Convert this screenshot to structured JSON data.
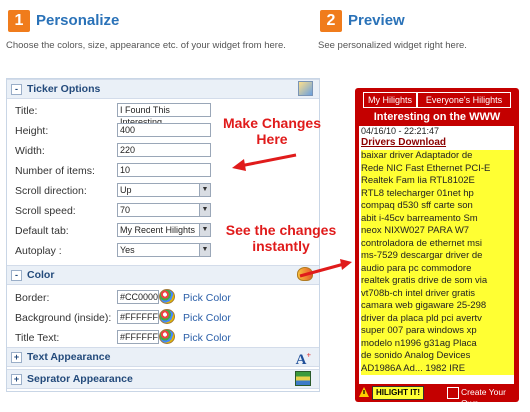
{
  "step1": {
    "number": "1",
    "title": "Personalize",
    "desc": "Choose the colors, size, appearance etc. of your widget from here."
  },
  "step2": {
    "number": "2",
    "title": "Preview",
    "desc": "See personalized widget right here."
  },
  "ticker_options": {
    "title": "Ticker Options",
    "toggle": "-",
    "fields": [
      {
        "label": "Title:",
        "value": "I Found This Interesting"
      },
      {
        "label": "Height:",
        "value": "400"
      },
      {
        "label": "Width:",
        "value": "220"
      },
      {
        "label": "Number of items:",
        "value": "10"
      },
      {
        "label": "Scroll direction:",
        "value": "Up"
      },
      {
        "label": "Scroll speed:",
        "value": "70"
      },
      {
        "label": "Default tab:",
        "value": "My Recent Hilights"
      },
      {
        "label": "Autoplay :",
        "value": "Yes"
      }
    ]
  },
  "color": {
    "title": "Color",
    "toggle": "-",
    "fields": [
      {
        "label": "Border:",
        "value": "#CC0000",
        "pick": "Pick Color"
      },
      {
        "label": "Background (inside):",
        "value": "#FFFFFF",
        "pick": "Pick Color"
      },
      {
        "label": "Title Text:",
        "value": "#FFFFFF",
        "pick": "Pick Color"
      }
    ]
  },
  "text_appearance": {
    "title": "Text Appearance",
    "toggle": "+"
  },
  "separator_appearance": {
    "title": "Seprator Appearance",
    "toggle": "+"
  },
  "callouts": {
    "top_line1": "Make Changes",
    "top_line2": "Here",
    "bottom_line1": "See the changes",
    "bottom_line2": "instantly"
  },
  "widget": {
    "tabs": [
      "My Hilights",
      "Everyone's Hilights"
    ],
    "header": "Interesting on the WWW",
    "timestamp": "04/16/10 - 22:21:47",
    "link": "Drivers Download",
    "body_lines": [
      "baixar driver Adaptador de",
      "Rede NIC Fast Ethernet PCI-E",
      "Realtek Fam lia RTL8102E",
      "RTL8 telecharger 01net hp",
      "compaq d530 sff carte son",
      "abit i-45cv barreamento Sm",
      "neox NIXW027 PARA W7",
      "controladora de ethernet msi",
      "ms-7529 descargar driver de",
      "audio para pc commodore",
      "realtek gratis drive de som via",
      "vt708b-ch intel driver gratis",
      "camara web gigaware 25-298",
      "driver da placa pld pci avertv",
      "super 007 para windows xp",
      "modelo n1996 g31ag Placa",
      "de sonido Analog Devices",
      "AD1986A Ad... 1982 IRE"
    ],
    "footer_left": "HILIGHT IT!",
    "footer_right": "Create Your Own"
  },
  "colors": {
    "accent": "#f07c1c",
    "title_blue": "#2a72b8",
    "widget_red": "#c40000",
    "highlight": "#ffff33",
    "callout_red": "#e01b1b"
  }
}
